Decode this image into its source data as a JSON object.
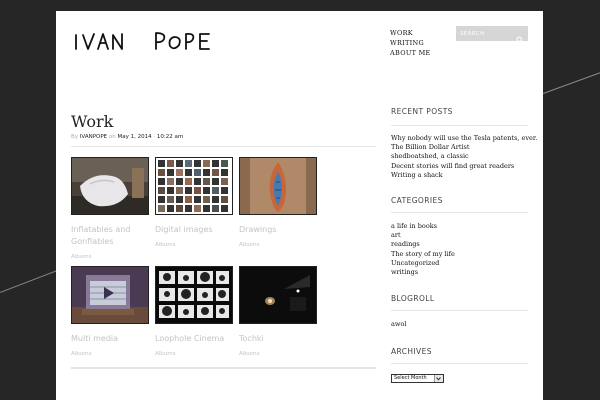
{
  "site": {
    "logo_text": "IVAN POPE"
  },
  "nav": {
    "items": [
      {
        "label": "WORK"
      },
      {
        "label": "WRITING"
      },
      {
        "label": "ABOUT ME"
      }
    ]
  },
  "search": {
    "placeholder": "SEARCH",
    "icon": "search-icon"
  },
  "post": {
    "title": "Work",
    "meta": {
      "by": "By",
      "author": "IVANPOPE",
      "on": "on",
      "date": "May 1, 2014",
      "sep": "·",
      "time": "10:22 am"
    }
  },
  "gallery": [
    {
      "caption": "Inflatables and Gonflables",
      "sub": "Albums",
      "icon": "inflatable-photo"
    },
    {
      "caption": "Digital images",
      "sub": "Albums",
      "icon": "digital-grid-photo"
    },
    {
      "caption": "Drawings",
      "sub": "Albums",
      "icon": "drawing-photo"
    },
    {
      "caption": "Multi media",
      "sub": "Albums",
      "icon": "multimedia-photo"
    },
    {
      "caption": "Loophole Cinema",
      "sub": "Albums",
      "icon": "cinema-photo"
    },
    {
      "caption": "Tochki",
      "sub": "Albums",
      "icon": "tochki-photo"
    }
  ],
  "sidebar": {
    "recent_posts": {
      "heading": "RECENT POSTS",
      "items": [
        "Why nobody will use the Tesla patents, ever.",
        "The Billion Dollar Artist",
        "shedboatshed, a classic",
        "Decent stories will find great readers",
        "Writing a shack"
      ]
    },
    "categories": {
      "heading": "CATEGORIES",
      "items": [
        "a life in books",
        "art",
        "readings",
        "The story of my life",
        "Uncategorized",
        "writings"
      ]
    },
    "blogroll": {
      "heading": "BLOGROLL",
      "items": [
        "awol"
      ]
    },
    "archives": {
      "heading": "ARCHIVES",
      "select_value": "Select Month"
    }
  },
  "colors": {
    "background": "#262626",
    "page": "#ffffff",
    "muted": "#c4c4c4",
    "rule": "#e6e6e6"
  }
}
